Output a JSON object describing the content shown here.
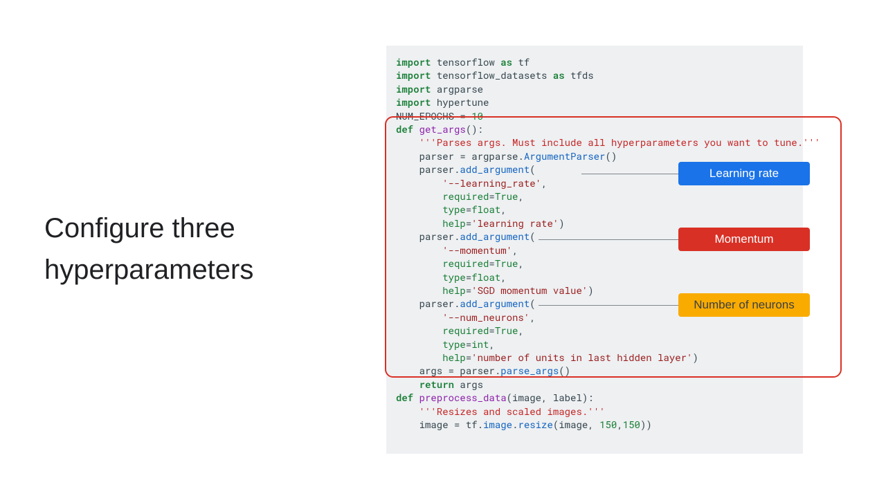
{
  "title": "Configure three hyperparameters",
  "callouts": {
    "lr": "Learning rate",
    "mom": "Momentum",
    "nn": "Number of neurons"
  },
  "code": {
    "l1_kw": "import",
    "l1_rest": " tensorflow ",
    "l1_as": "as",
    "l1_alias": " tf",
    "l2_kw": "import",
    "l2_rest": " tensorflow_datasets ",
    "l2_as": "as",
    "l2_alias": " tfds",
    "l3_kw": "import",
    "l3_rest": " argparse",
    "l4_kw": "import",
    "l4_rest": " hypertune",
    "l5a": "NUM_EPOCHS = ",
    "l5n": "10",
    "l6_def": "def ",
    "l6_fn": "get_args",
    "l6_par": "():",
    "l7_doc": "    '''Parses args. Must include all hyperparameters you want to tune.'''",
    "l8a": "    parser = argparse.",
    "l8b": "ArgumentParser",
    "l8c": "()",
    "l9a": "    parser.",
    "l9b": "add_argument",
    "l9c": "(",
    "l10s": "        '--learning_rate'",
    "l10c": ",",
    "l11k": "        required",
    "l11e": "=",
    "l11v": "True",
    "l11c": ",",
    "l12k": "        type",
    "l12e": "=",
    "l12v": "float",
    "l12c": ",",
    "l13k": "        help",
    "l13e": "=",
    "l13v": "'learning rate'",
    "l13c": ")",
    "l14a": "    parser.",
    "l14b": "add_argument",
    "l14c": "(",
    "l15s": "        '--momentum'",
    "l15c": ",",
    "l16k": "        required",
    "l16e": "=",
    "l16v": "True",
    "l16c": ",",
    "l17k": "        type",
    "l17e": "=",
    "l17v": "float",
    "l17c": ",",
    "l18k": "        help",
    "l18e": "=",
    "l18v": "'SGD momentum value'",
    "l18c": ")",
    "l19a": "    parser.",
    "l19b": "add_argument",
    "l19c": "(",
    "l20s": "        '--num_neurons'",
    "l20c": ",",
    "l21k": "        required",
    "l21e": "=",
    "l21v": "True",
    "l21c": ",",
    "l22k": "        type",
    "l22e": "=",
    "l22v": "int",
    "l22c": ",",
    "l23k": "        help",
    "l23e": "=",
    "l23v": "'number of units in last hidden layer'",
    "l23c": ")",
    "l24a": "    args = parser.",
    "l24b": "parse_args",
    "l24c": "()",
    "l25_ret": "    return ",
    "l25_v": "args",
    "l26_def": "def ",
    "l26_fn": "preprocess_data",
    "l26_par": "(image, label):",
    "l27_doc": "    '''Resizes and scaled images.'''",
    "l28a": "    image = tf.",
    "l28b": "image",
    "l28c": ".",
    "l28d": "resize",
    "l28e": "(image, ",
    "l28n1": "150",
    "l28f": ",",
    "l28n2": "150",
    "l28g": "))"
  }
}
